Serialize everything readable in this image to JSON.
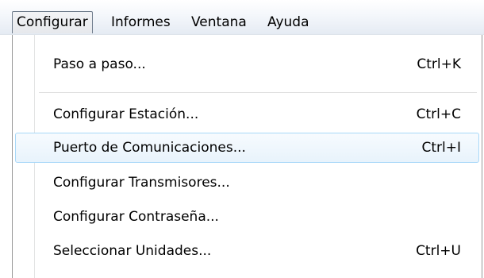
{
  "menubar": {
    "items": [
      {
        "label": "Configurar"
      },
      {
        "label": "Informes"
      },
      {
        "label": "Ventana"
      },
      {
        "label": "Ayuda"
      }
    ]
  },
  "dropdown": {
    "items": [
      {
        "label": "Paso a paso...",
        "shortcut": "Ctrl+K"
      },
      {
        "label": "Configurar Estación...",
        "shortcut": "Ctrl+C"
      },
      {
        "label": "Puerto de Comunicaciones...",
        "shortcut": "Ctrl+I"
      },
      {
        "label": "Configurar Transmisores...",
        "shortcut": ""
      },
      {
        "label": "Configurar Contraseña...",
        "shortcut": ""
      },
      {
        "label": "Seleccionar Unidades...",
        "shortcut": "Ctrl+U"
      }
    ]
  }
}
